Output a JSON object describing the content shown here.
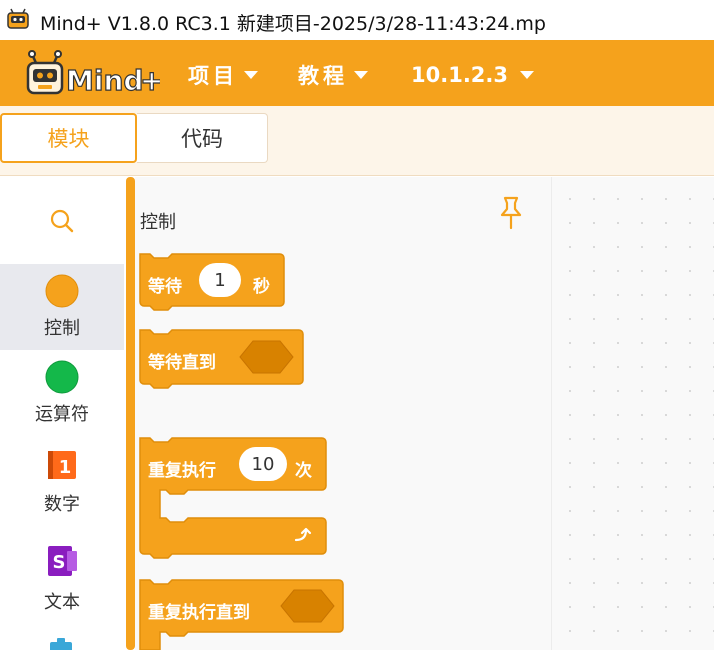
{
  "window": {
    "title": "Mind+ V1.8.0 RC3.1    新建项目-2025/3/28-11:43:24.mp"
  },
  "menubar": {
    "items": [
      {
        "label": "项目"
      },
      {
        "label": "教程"
      },
      {
        "label": "10.1.2.3"
      }
    ],
    "colors": {
      "accent": "#f5a21c"
    }
  },
  "tabs": [
    {
      "label": "模块",
      "active": true
    },
    {
      "label": "代码",
      "active": false
    }
  ],
  "sidebar": {
    "search_icon": "search-icon",
    "categories": [
      {
        "label": "控制",
        "icon": "orange-circle-icon",
        "color": "#f5a21c",
        "selected": true
      },
      {
        "label": "运算符",
        "icon": "green-circle-icon",
        "color": "#14b84a",
        "selected": false
      },
      {
        "label": "数字",
        "icon": "number-square-icon",
        "color": "#ff6a1a",
        "icon_text": "1",
        "selected": false
      },
      {
        "label": "文本",
        "icon": "text-s-icon",
        "color": "#8a1dbf",
        "icon_text": "S",
        "selected": false
      }
    ]
  },
  "palette": {
    "section_title": "控制",
    "blocks": [
      {
        "kind": "wait",
        "text_before": "等待",
        "value": "1",
        "text_after": "秒"
      },
      {
        "kind": "wait-until",
        "text": "等待直到"
      },
      {
        "kind": "repeat",
        "text_before": "重复执行",
        "value": "10",
        "text_after": "次"
      },
      {
        "kind": "repeat-until",
        "text": "重复执行直到"
      }
    ],
    "block_color": "#f5a21c",
    "block_border": "#e08e0b"
  }
}
